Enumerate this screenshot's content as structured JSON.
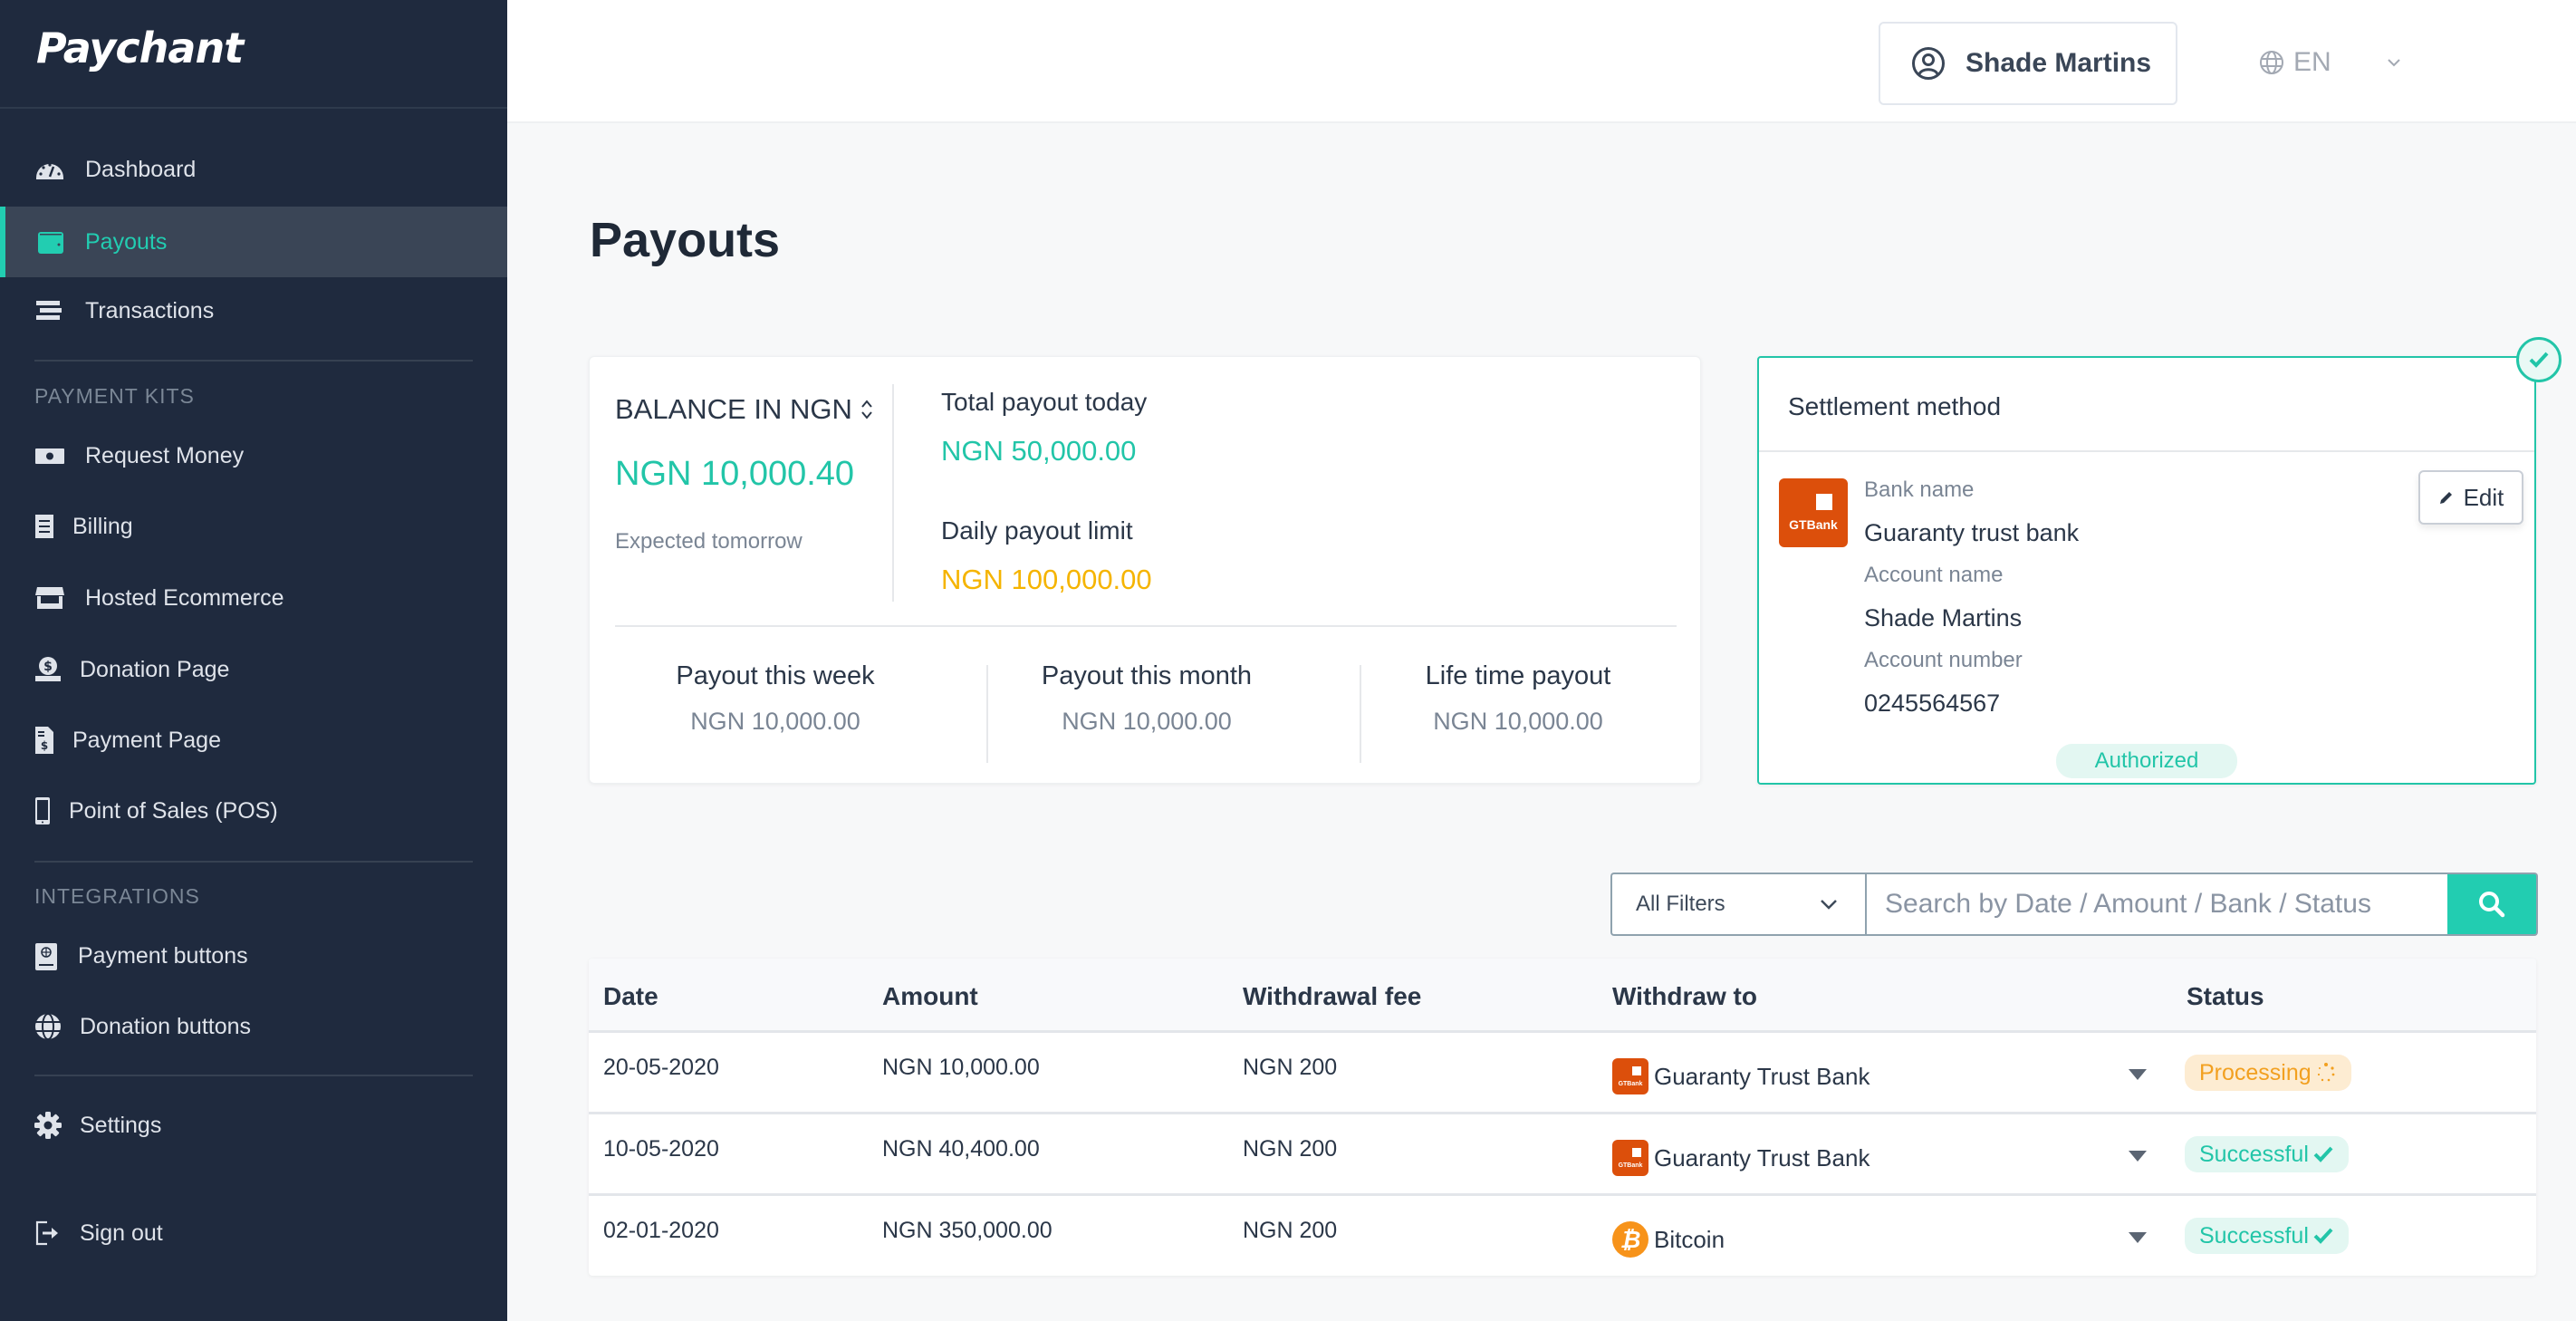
{
  "app": {
    "name": "Paychant"
  },
  "colors": {
    "accent": "#22cdb1",
    "warning": "#f5b400",
    "sidebar_bg": "#1f2a3e",
    "gtbank": "#dc4f0b",
    "bitcoin": "#f7931a"
  },
  "sidebar": {
    "top_items": [
      {
        "label": "Dashboard",
        "icon": "dashboard-icon"
      },
      {
        "label": "Payouts",
        "icon": "wallet-icon",
        "active": true
      },
      {
        "label": "Transactions",
        "icon": "list-icon"
      }
    ],
    "payment_kits": {
      "heading": "PAYMENT KITS",
      "items": [
        {
          "label": "Request Money",
          "icon": "money-bill-icon"
        },
        {
          "label": "Billing",
          "icon": "receipt-icon"
        },
        {
          "label": "Hosted Ecommerce",
          "icon": "store-icon"
        },
        {
          "label": "Donation Page",
          "icon": "donate-icon"
        },
        {
          "label": "Payment Page",
          "icon": "invoice-icon"
        },
        {
          "label": "Point of Sales (POS)",
          "icon": "mobile-icon"
        }
      ]
    },
    "integrations": {
      "heading": "INTEGRATIONS",
      "items": [
        {
          "label": "Payment buttons",
          "icon": "passport-icon"
        },
        {
          "label": "Donation buttons",
          "icon": "globe-icon"
        }
      ]
    },
    "settings": {
      "label": "Settings",
      "icon": "gear-icon"
    },
    "signout": {
      "label": "Sign out",
      "icon": "sign-out-icon"
    }
  },
  "header": {
    "user_name": "Shade Martins",
    "language": "EN"
  },
  "page": {
    "title": "Payouts"
  },
  "balance": {
    "label": "BALANCE IN NGN",
    "value": "NGN 10,000.40",
    "note": "Expected tomorrow",
    "total_today_label": "Total payout today",
    "total_today_value": "NGN 50,000.00",
    "daily_limit_label": "Daily payout limit",
    "daily_limit_value": "NGN 100,000.00",
    "summary": [
      {
        "label": "Payout this week",
        "value": "NGN 10,000.00"
      },
      {
        "label": "Payout this month",
        "value": "NGN 10,000.00"
      },
      {
        "label": "Life time payout",
        "value": "NGN 10,000.00"
      }
    ]
  },
  "settlement": {
    "title": "Settlement method",
    "bank_logo_text": "GTBank",
    "bank_name_label": "Bank name",
    "bank_name": "Guaranty trust bank",
    "account_name_label": "Account name",
    "account_name": "Shade Martins",
    "account_number_label": "Account number",
    "account_number": "0245564567",
    "edit_label": "Edit",
    "status": "Authorized"
  },
  "search": {
    "filter_value": "All Filters",
    "placeholder": "Search by Date / Amount / Bank / Status"
  },
  "table": {
    "columns": [
      "Date",
      "Amount",
      "Withdrawal fee",
      "Withdraw to",
      "Status"
    ],
    "rows": [
      {
        "date": "20-05-2020",
        "amount": "NGN 10,000.00",
        "fee": "NGN 200",
        "withdraw_to": "Guaranty Trust Bank",
        "method": "gtbank",
        "status": "Processing",
        "status_type": "processing"
      },
      {
        "date": "10-05-2020",
        "amount": "NGN 40,400.00",
        "fee": "NGN 200",
        "withdraw_to": "Guaranty Trust Bank",
        "method": "gtbank",
        "status": "Successful",
        "status_type": "success"
      },
      {
        "date": "02-01-2020",
        "amount": "NGN 350,000.00",
        "fee": "NGN 200",
        "withdraw_to": "Bitcoin",
        "method": "bitcoin",
        "status": "Successful",
        "status_type": "success"
      }
    ]
  }
}
